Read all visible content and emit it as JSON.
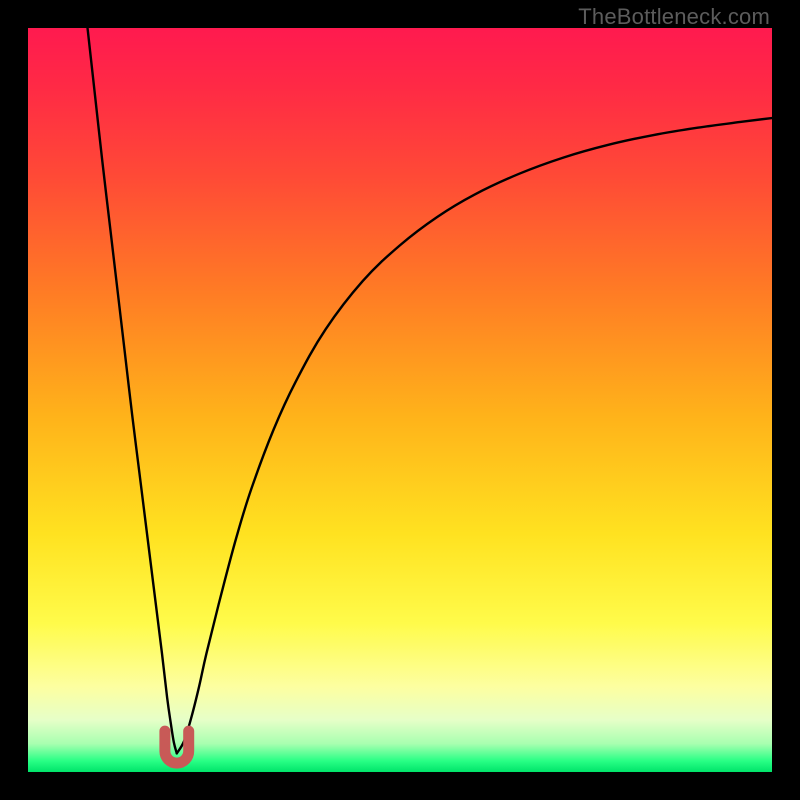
{
  "watermark": "TheBottleneck.com",
  "colors": {
    "black": "#000000",
    "curve": "#000000",
    "marker": "#c85a57",
    "gradient_stops": [
      {
        "offset": 0.0,
        "color": "#ff1a4f"
      },
      {
        "offset": 0.08,
        "color": "#ff2a45"
      },
      {
        "offset": 0.2,
        "color": "#ff4a36"
      },
      {
        "offset": 0.35,
        "color": "#ff7a25"
      },
      {
        "offset": 0.52,
        "color": "#ffb21a"
      },
      {
        "offset": 0.68,
        "color": "#ffe220"
      },
      {
        "offset": 0.8,
        "color": "#fffb4a"
      },
      {
        "offset": 0.885,
        "color": "#fdffa0"
      },
      {
        "offset": 0.93,
        "color": "#e6ffc8"
      },
      {
        "offset": 0.962,
        "color": "#a8ffb0"
      },
      {
        "offset": 0.985,
        "color": "#29ff85"
      },
      {
        "offset": 1.0,
        "color": "#00e46a"
      }
    ]
  },
  "chart_data": {
    "type": "line",
    "title": "",
    "xlabel": "",
    "ylabel": "",
    "xlim": [
      0,
      100
    ],
    "ylim": [
      0,
      100
    ],
    "minimum_x": 20,
    "series": [
      {
        "name": "left-branch",
        "x": [
          8,
          9,
          10,
          11,
          12,
          13,
          14,
          15,
          16,
          17,
          18,
          18.7,
          19.2,
          19.6,
          20
        ],
        "values": [
          100,
          91,
          82,
          73.5,
          65,
          56.5,
          48,
          40,
          32,
          24,
          16,
          10,
          6.5,
          4,
          2.5
        ]
      },
      {
        "name": "right-branch",
        "x": [
          20,
          21,
          22,
          23,
          24,
          26,
          28,
          30,
          33,
          36,
          40,
          45,
          50,
          55,
          60,
          66,
          72,
          78,
          84,
          90,
          96,
          100
        ],
        "values": [
          2.5,
          4.2,
          7.5,
          11.5,
          16,
          24,
          31.5,
          38,
          46,
          52.5,
          59.5,
          66,
          70.8,
          74.6,
          77.6,
          80.4,
          82.6,
          84.3,
          85.6,
          86.6,
          87.4,
          87.9
        ]
      }
    ],
    "marker": {
      "name": "minimum-u-marker",
      "x_center": 20,
      "x_halfwidth": 1.6,
      "y_top": 5.5,
      "y_bottom": 1.2
    }
  }
}
